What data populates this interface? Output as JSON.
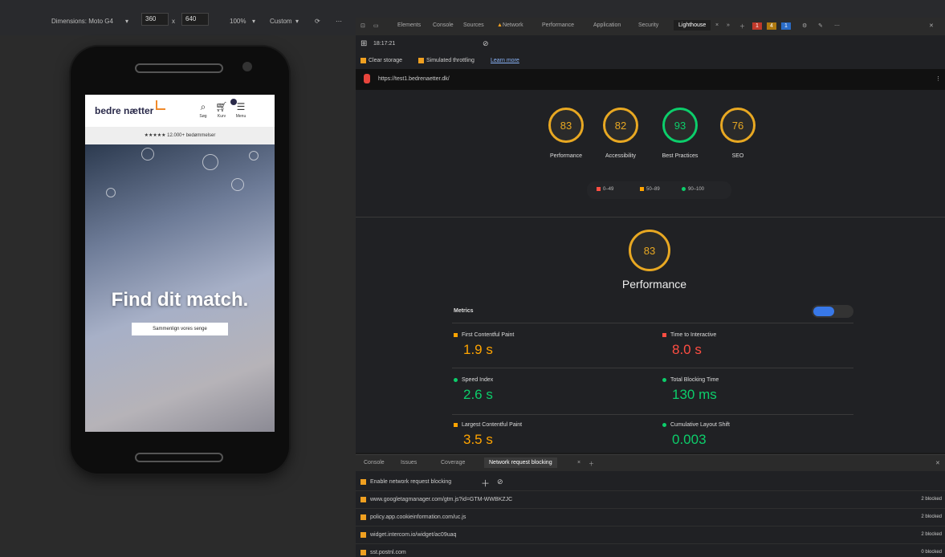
{
  "device_toolbar": {
    "dimensions_label": "Dimensions: Moto G4",
    "width": "360",
    "x": "x",
    "height": "640",
    "zoom": "100%",
    "throttle": "Custom"
  },
  "devtools_tabs": [
    "Elements",
    "Console",
    "Sources",
    "Network",
    "Performance",
    "Application",
    "Security",
    "Lighthouse"
  ],
  "counters": {
    "errors": "1",
    "warnings": "4",
    "info": "1"
  },
  "lighthouse": {
    "report_time": "18:17:21",
    "clear_storage": "Clear storage",
    "simulated_throttling": "Simulated throttling",
    "learn_more": "Learn more",
    "url": "https://test1.bedrenaetter.dk/",
    "scores": [
      {
        "value": "83",
        "label": "Performance",
        "color": "orange"
      },
      {
        "value": "82",
        "label": "Accessibility",
        "color": "orange"
      },
      {
        "value": "93",
        "label": "Best Practices",
        "color": "green"
      },
      {
        "value": "76",
        "label": "SEO",
        "color": "orange"
      }
    ],
    "legend": [
      "0–49",
      "50–89",
      "90–100"
    ],
    "performance_score": "83",
    "performance_title": "Performance",
    "metrics_label": "Metrics",
    "metrics": [
      {
        "title": "First Contentful Paint",
        "value": "1.9 s",
        "status": "orange"
      },
      {
        "title": "Time to Interactive",
        "value": "8.0 s",
        "status": "red"
      },
      {
        "title": "Speed Index",
        "value": "2.6 s",
        "status": "green"
      },
      {
        "title": "Total Blocking Time",
        "value": "130 ms",
        "status": "green"
      },
      {
        "title": "Largest Contentful Paint",
        "value": "3.5 s",
        "status": "orange"
      },
      {
        "title": "Cumulative Layout Shift",
        "value": "0.003",
        "status": "green"
      }
    ]
  },
  "phone_site": {
    "logo": "bedre nætter",
    "search_label": "Søg",
    "cart_label": "Kurv",
    "menu_label": "Menu",
    "rating_text": "★★★★★ 12.000+ bedømmelser",
    "hero_title": "Find dit match.",
    "hero_button": "Sammenlign vores senge"
  },
  "drawer": {
    "tabs": [
      "Console",
      "Issues",
      "Coverage",
      "Network request blocking"
    ],
    "enable_label": "Enable network request blocking",
    "rows": [
      {
        "pattern": "www.googletagmanager.com/gtm.js?id=GTM-WWBKZJC",
        "status": "2 blocked"
      },
      {
        "pattern": "policy.app.cookieinformation.com/uc.js",
        "status": "2 blocked"
      },
      {
        "pattern": "widget.intercom.io/widget/ac09uaq",
        "status": "2 blocked"
      },
      {
        "pattern": "sst.postnl.com",
        "status": "0 blocked"
      }
    ]
  }
}
